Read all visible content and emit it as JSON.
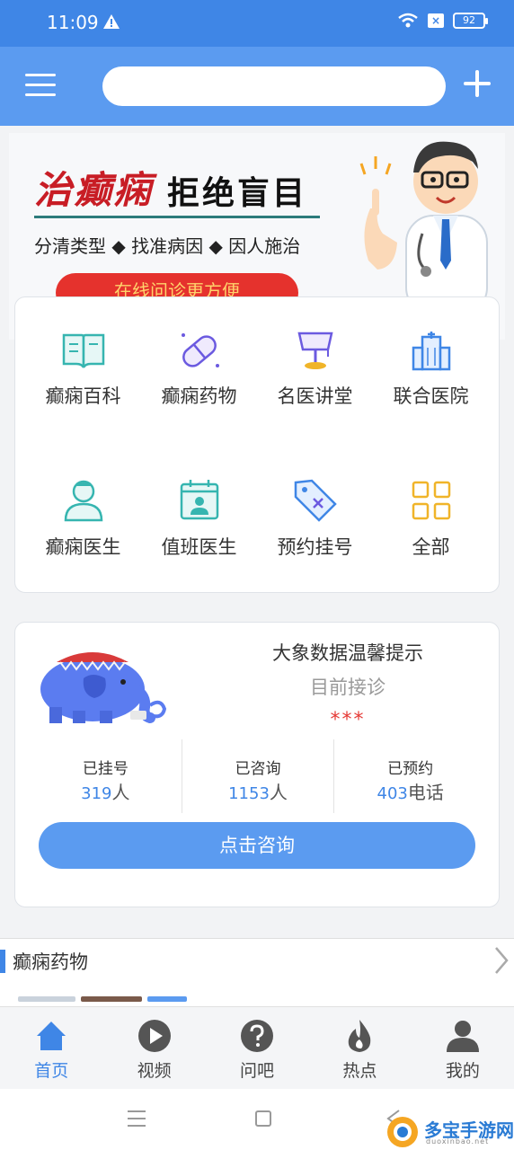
{
  "status_bar": {
    "time": "11:09",
    "battery": "92"
  },
  "header": {
    "search_placeholder": ""
  },
  "banner": {
    "title_red": "治癫痫",
    "title_black": "拒绝盲目",
    "subtitle": "分清类型 ◆ 找准病因 ◆ 因人施治",
    "cta": "在线问诊更方便"
  },
  "grid": {
    "items": [
      {
        "label": "癫痫百科",
        "icon": "book-icon"
      },
      {
        "label": "癫痫药物",
        "icon": "pill-icon"
      },
      {
        "label": "名医讲堂",
        "icon": "lamp-icon"
      },
      {
        "label": "联合医院",
        "icon": "hospital-icon"
      },
      {
        "label": "癫痫医生",
        "icon": "doctor-icon"
      },
      {
        "label": "值班医生",
        "icon": "calendar-icon"
      },
      {
        "label": "预约挂号",
        "icon": "tag-icon"
      },
      {
        "label": "全部",
        "icon": "grid-icon"
      }
    ]
  },
  "info": {
    "title": "大象数据温馨提示",
    "subtitle": "目前接诊",
    "stars": "***",
    "stats": [
      {
        "label": "已挂号",
        "value": "319",
        "unit": "人"
      },
      {
        "label": "已咨询",
        "value": "1153",
        "unit": "人"
      },
      {
        "label": "已预约",
        "value": "403",
        "unit": "电话"
      }
    ],
    "button": "点击咨询"
  },
  "section": {
    "title": "癫痫药物"
  },
  "tabbar": {
    "items": [
      {
        "label": "首页",
        "icon": "home-icon"
      },
      {
        "label": "视频",
        "icon": "play-icon"
      },
      {
        "label": "问吧",
        "icon": "question-icon"
      },
      {
        "label": "热点",
        "icon": "fire-icon"
      },
      {
        "label": "我的",
        "icon": "user-icon"
      }
    ]
  },
  "watermark": {
    "text": "多宝手游网",
    "sub": "duoxinbao.net"
  },
  "colors": {
    "primary": "#5b9bf0",
    "status_bar": "#3f86e6",
    "accent_red": "#e53935",
    "icon_teal": "#36b5b0",
    "icon_purple": "#6b5ae0",
    "icon_yellow": "#f0b429"
  }
}
